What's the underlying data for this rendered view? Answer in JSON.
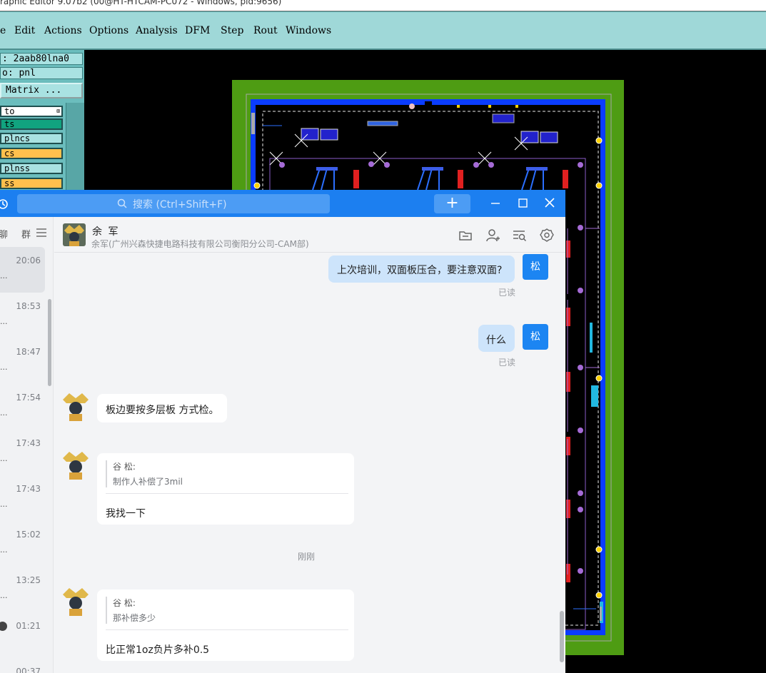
{
  "cam": {
    "title": "raphic Editor 9.07b2 (00@HT-HTCAM-PC072 - Windows, pid:9656)",
    "menu": [
      "e",
      "Edit",
      "Actions",
      "Options",
      "Analysis",
      "DFM",
      "Step",
      "Rout",
      "Windows"
    ],
    "job_field": ": 2aab80lna0",
    "step_field": "o: pnl",
    "matrix_button": "Matrix ...",
    "layers": [
      {
        "name": "to",
        "color": "#ffffff"
      },
      {
        "name": "ts",
        "color": "#11a37f"
      },
      {
        "name": "plncs",
        "color": "#a9e2e2"
      },
      {
        "name": "cs",
        "color": "#ffc04d"
      },
      {
        "name": "plnss",
        "color": "#a9e2e2"
      },
      {
        "name": "ss",
        "color": "#ffc04d"
      }
    ]
  },
  "chat": {
    "search_placeholder": "搜索 (Ctrl+Shift+F)",
    "add_label": "+",
    "conversations": [
      {
        "time": "20:06",
        "preview": "...",
        "active": true
      },
      {
        "time": "18:53",
        "preview": "..."
      },
      {
        "time": "18:47",
        "preview": "..."
      },
      {
        "time": "17:54",
        "preview": "..."
      },
      {
        "time": "17:43",
        "preview": "..."
      },
      {
        "time": "17:43",
        "preview": "..."
      },
      {
        "time": "15:02",
        "preview": "..."
      },
      {
        "time": "13:25",
        "preview": "..."
      },
      {
        "time": "01:21",
        "preview": ""
      },
      {
        "time": "00:37",
        "preview": ""
      }
    ],
    "list_tabs": [
      "聊",
      "群"
    ],
    "header": {
      "name": "余 军",
      "subtitle": "余军(广州兴森快捷电路科技有限公司衡阳分公司-CAM部)"
    },
    "me_avatar_label": "松",
    "read_label": "已读",
    "messages": {
      "m1": "上次培训，双面板压合，要注意双面?",
      "m2": "什么",
      "m3": "板边要按多层板 方式检。",
      "m4_quote_name": "谷 松:",
      "m4_quote_text": "制作人补偿了3mil",
      "m4_reply": "我找一下",
      "time_sep": "刚刚",
      "m5_quote_name": "谷 松:",
      "m5_quote_text": "那补偿多少",
      "m5_reply": "比正常1oz负片多补0.5"
    },
    "colors": {
      "titlebar": "#1c7ff0",
      "my_bubble": "#cde4fb",
      "my_avatar": "#1c85f2"
    }
  }
}
